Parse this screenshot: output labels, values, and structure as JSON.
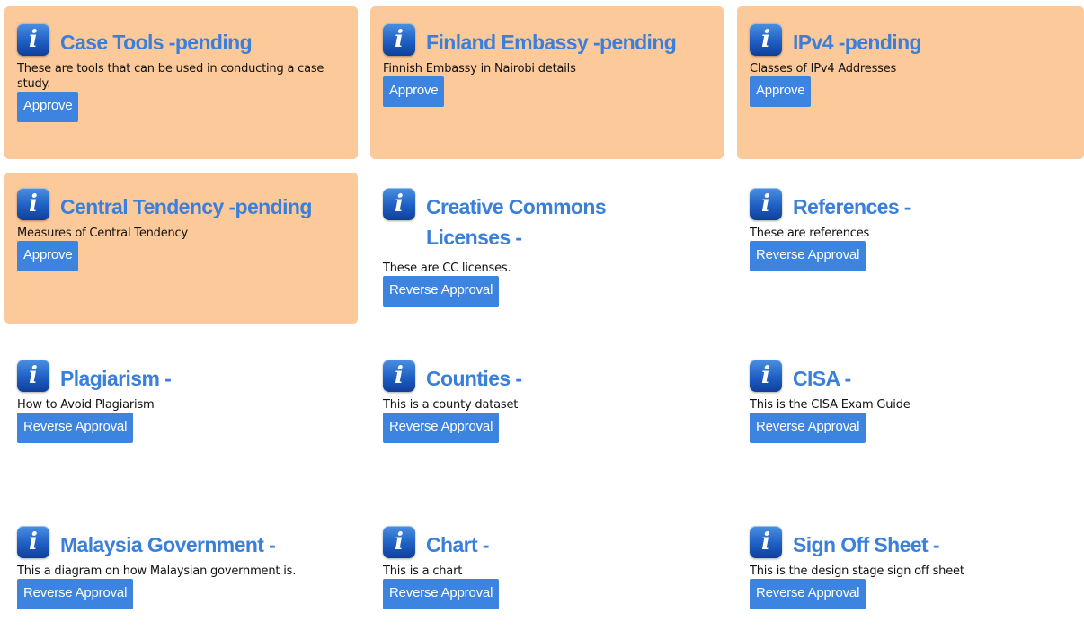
{
  "cards": [
    {
      "title": "Case Tools -pending",
      "description": "These are tools that can be used in conducting a case study.",
      "button": "Approve",
      "pending": true
    },
    {
      "title": "Finland Embassy -pending",
      "description": "Finnish Embassy in Nairobi details",
      "button": "Approve",
      "pending": true
    },
    {
      "title": "IPv4 -pending",
      "description": "Classes of IPv4 Addresses",
      "button": "Approve",
      "pending": true
    },
    {
      "title": "Central Tendency -pending",
      "description": "Measures of Central Tendency",
      "button": "Approve",
      "pending": true
    },
    {
      "title": "Creative Commons Licenses -",
      "description": "These are CC licenses.",
      "button": "Reverse Approval",
      "pending": false
    },
    {
      "title": "References -",
      "description": "These are references",
      "button": "Reverse Approval",
      "pending": false
    },
    {
      "title": "Plagiarism -",
      "description": "How to Avoid Plagiarism",
      "button": "Reverse Approval",
      "pending": false
    },
    {
      "title": "Counties -",
      "description": "This is a county dataset",
      "button": "Reverse Approval",
      "pending": false
    },
    {
      "title": "CISA -",
      "description": "This is the CISA Exam Guide",
      "button": "Reverse Approval",
      "pending": false
    },
    {
      "title": "Malaysia Government -",
      "description": "This a diagram on how Malaysian government is.",
      "button": "Reverse Approval",
      "pending": false
    },
    {
      "title": "Chart -",
      "description": "This is a chart",
      "button": "Reverse Approval",
      "pending": false
    },
    {
      "title": "Sign Off Sheet -",
      "description": "This is the design stage sign off sheet",
      "button": "Reverse Approval",
      "pending": false
    }
  ],
  "icons": {
    "info": "info-icon",
    "glyph": "i"
  },
  "colors": {
    "pending_bg": "#fcc99a",
    "title": "#3a7fd9",
    "button": "#3c84e0"
  }
}
